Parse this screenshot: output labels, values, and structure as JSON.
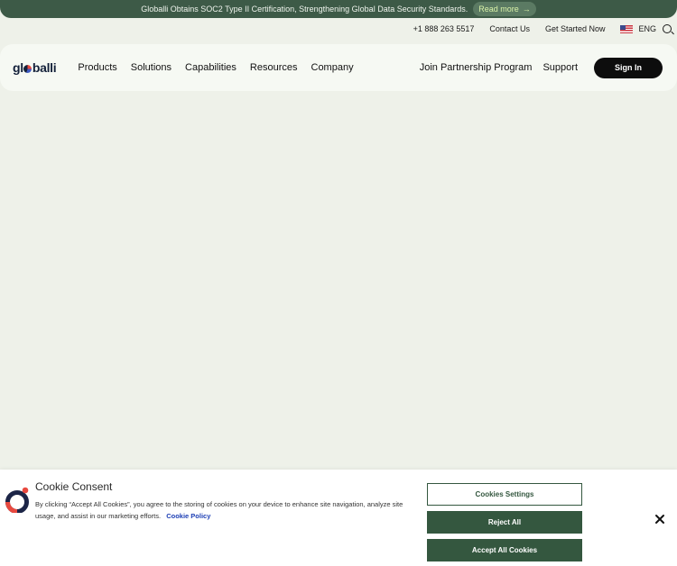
{
  "announcement": {
    "text": "Globalli Obtains SOC2 Type II Certification, Strengthening Global Data Security Standards.",
    "cta": "Read more",
    "cta_arrow": "→"
  },
  "utility_bar": {
    "phone": "+1 888 263 5517",
    "contact": "Contact Us",
    "get_started": "Get Started Now",
    "language": "ENG",
    "flag_icon": "us-flag-icon",
    "search_icon": "search-icon"
  },
  "navbar": {
    "logo": {
      "pre": "gl",
      "post": "balli"
    },
    "links": [
      "Products",
      "Solutions",
      "Capabilities",
      "Resources",
      "Company"
    ],
    "partner": "Join Partnership Program",
    "support": "Support",
    "sign_in": "Sign In"
  },
  "cookie": {
    "title": "Cookie Consent",
    "body": "By clicking “Accept All Cookies”, you agree to the storing of cookies on your device to enhance site navigation, analyze site usage, and assist in our marketing efforts.",
    "policy_link": "Cookie Policy",
    "settings_button": "Cookies Settings",
    "reject_button": "Reject All",
    "accept_button": "Accept All Cookies",
    "close_icon": "close-icon"
  },
  "colors": {
    "announcement_bg": "#3d5a47",
    "page_bg": "#eef1e9",
    "navbar_bg": "#f6f9f3",
    "button_green": "#34573f",
    "sign_in_bg": "#0d0d0d",
    "link_blue": "#1d3fb5"
  }
}
